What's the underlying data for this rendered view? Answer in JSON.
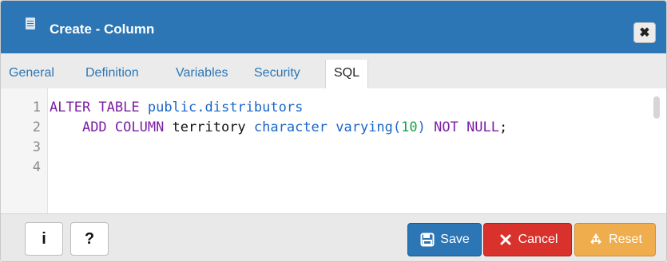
{
  "dialog": {
    "title": "Create - Column",
    "close_label": "✖",
    "tabs": [
      {
        "label": "General"
      },
      {
        "label": "Definition"
      },
      {
        "label": "Variables"
      },
      {
        "label": "Security"
      },
      {
        "label": "SQL",
        "active": true
      }
    ]
  },
  "editor": {
    "line_numbers": [
      "1",
      "2",
      "3",
      "4"
    ],
    "lines": [
      "ALTER TABLE public.distributors",
      "    ADD COLUMN territory character varying(10) NOT NULL;",
      "",
      ""
    ]
  },
  "footer": {
    "info_label": "i",
    "help_label": "?",
    "save_label": "Save",
    "cancel_label": "Cancel",
    "reset_label": "Reset"
  },
  "colors": {
    "primary": "#2c76b5",
    "danger": "#d9312b",
    "warning": "#f0ad4e",
    "sql_keyword": "#7b1fa2",
    "sql_type": "#1b66c9",
    "sql_number": "#16a34a"
  }
}
